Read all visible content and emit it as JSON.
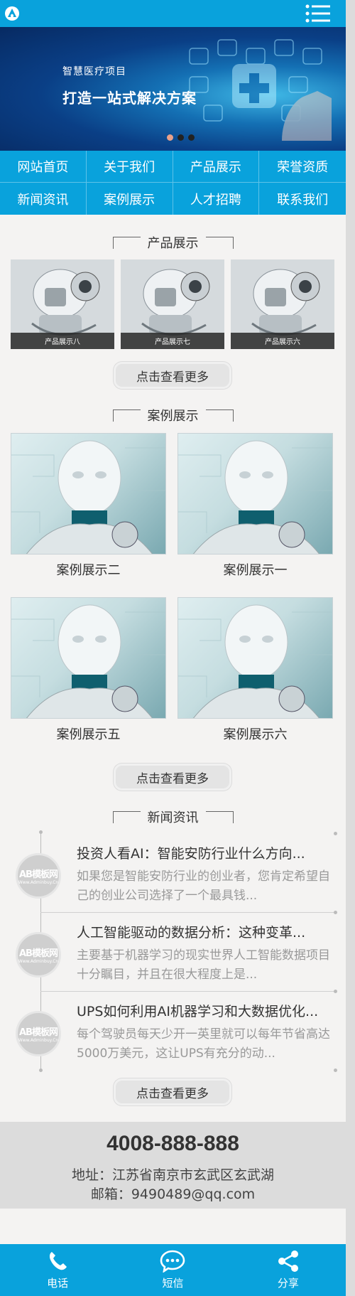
{
  "colors": {
    "brand": "#09a2dc",
    "background": "#f4f3f2",
    "contact_bg": "#dcdcdc"
  },
  "header": {
    "logo_icon": "logo-icon",
    "menu_icon": "menu-icon"
  },
  "banner": {
    "subtitle": "智慧医疗项目",
    "title": "打造一站式解决方案",
    "slides": 3,
    "active_slide": 1
  },
  "nav": {
    "items": [
      {
        "label": "网站首页"
      },
      {
        "label": "关于我们"
      },
      {
        "label": "产品展示"
      },
      {
        "label": "荣誉资质"
      },
      {
        "label": "新闻资讯"
      },
      {
        "label": "案例展示"
      },
      {
        "label": "人才招聘"
      },
      {
        "label": "联系我们"
      }
    ]
  },
  "products": {
    "title": "产品展示",
    "items": [
      {
        "caption": "产品展示八"
      },
      {
        "caption": "产品展示七"
      },
      {
        "caption": "产品展示六"
      }
    ],
    "more": "点击查看更多"
  },
  "cases": {
    "title": "案例展示",
    "items": [
      {
        "label": "案例展示二"
      },
      {
        "label": "案例展示一"
      },
      {
        "label": "案例展示五"
      },
      {
        "label": "案例展示六"
      }
    ],
    "more": "点击查看更多"
  },
  "news": {
    "title": "新闻资讯",
    "avatar_text": "AB模板网",
    "avatar_sub": "Www.Adminbuy.Cn",
    "items": [
      {
        "title": "投资人看AI：智能安防行业什么方向...",
        "desc": "如果您是智能安防行业的创业者，您肯定希望自己的创业公司选择了一个最具钱..."
      },
      {
        "title": "人工智能驱动的数据分析：这种变革...",
        "desc": "主要基于机器学习的现实世界人工智能数据项目十分瞩目，并且在很大程度上是..."
      },
      {
        "title": "UPS如何利用AI机器学习和大数据优化...",
        "desc": "每个驾驶员每天少开一英里就可以每年节省高达5000万美元，这让UPS有充分的动..."
      }
    ],
    "more": "点击查看更多"
  },
  "contact": {
    "phone": "4008-888-888",
    "address": "地址：江苏省南京市玄武区玄武湖",
    "email": "邮箱：9490489@qq.com"
  },
  "bottombar": {
    "items": [
      {
        "label": "电话",
        "icon": "phone-icon"
      },
      {
        "label": "短信",
        "icon": "message-icon"
      },
      {
        "label": "分享",
        "icon": "share-icon"
      }
    ]
  }
}
